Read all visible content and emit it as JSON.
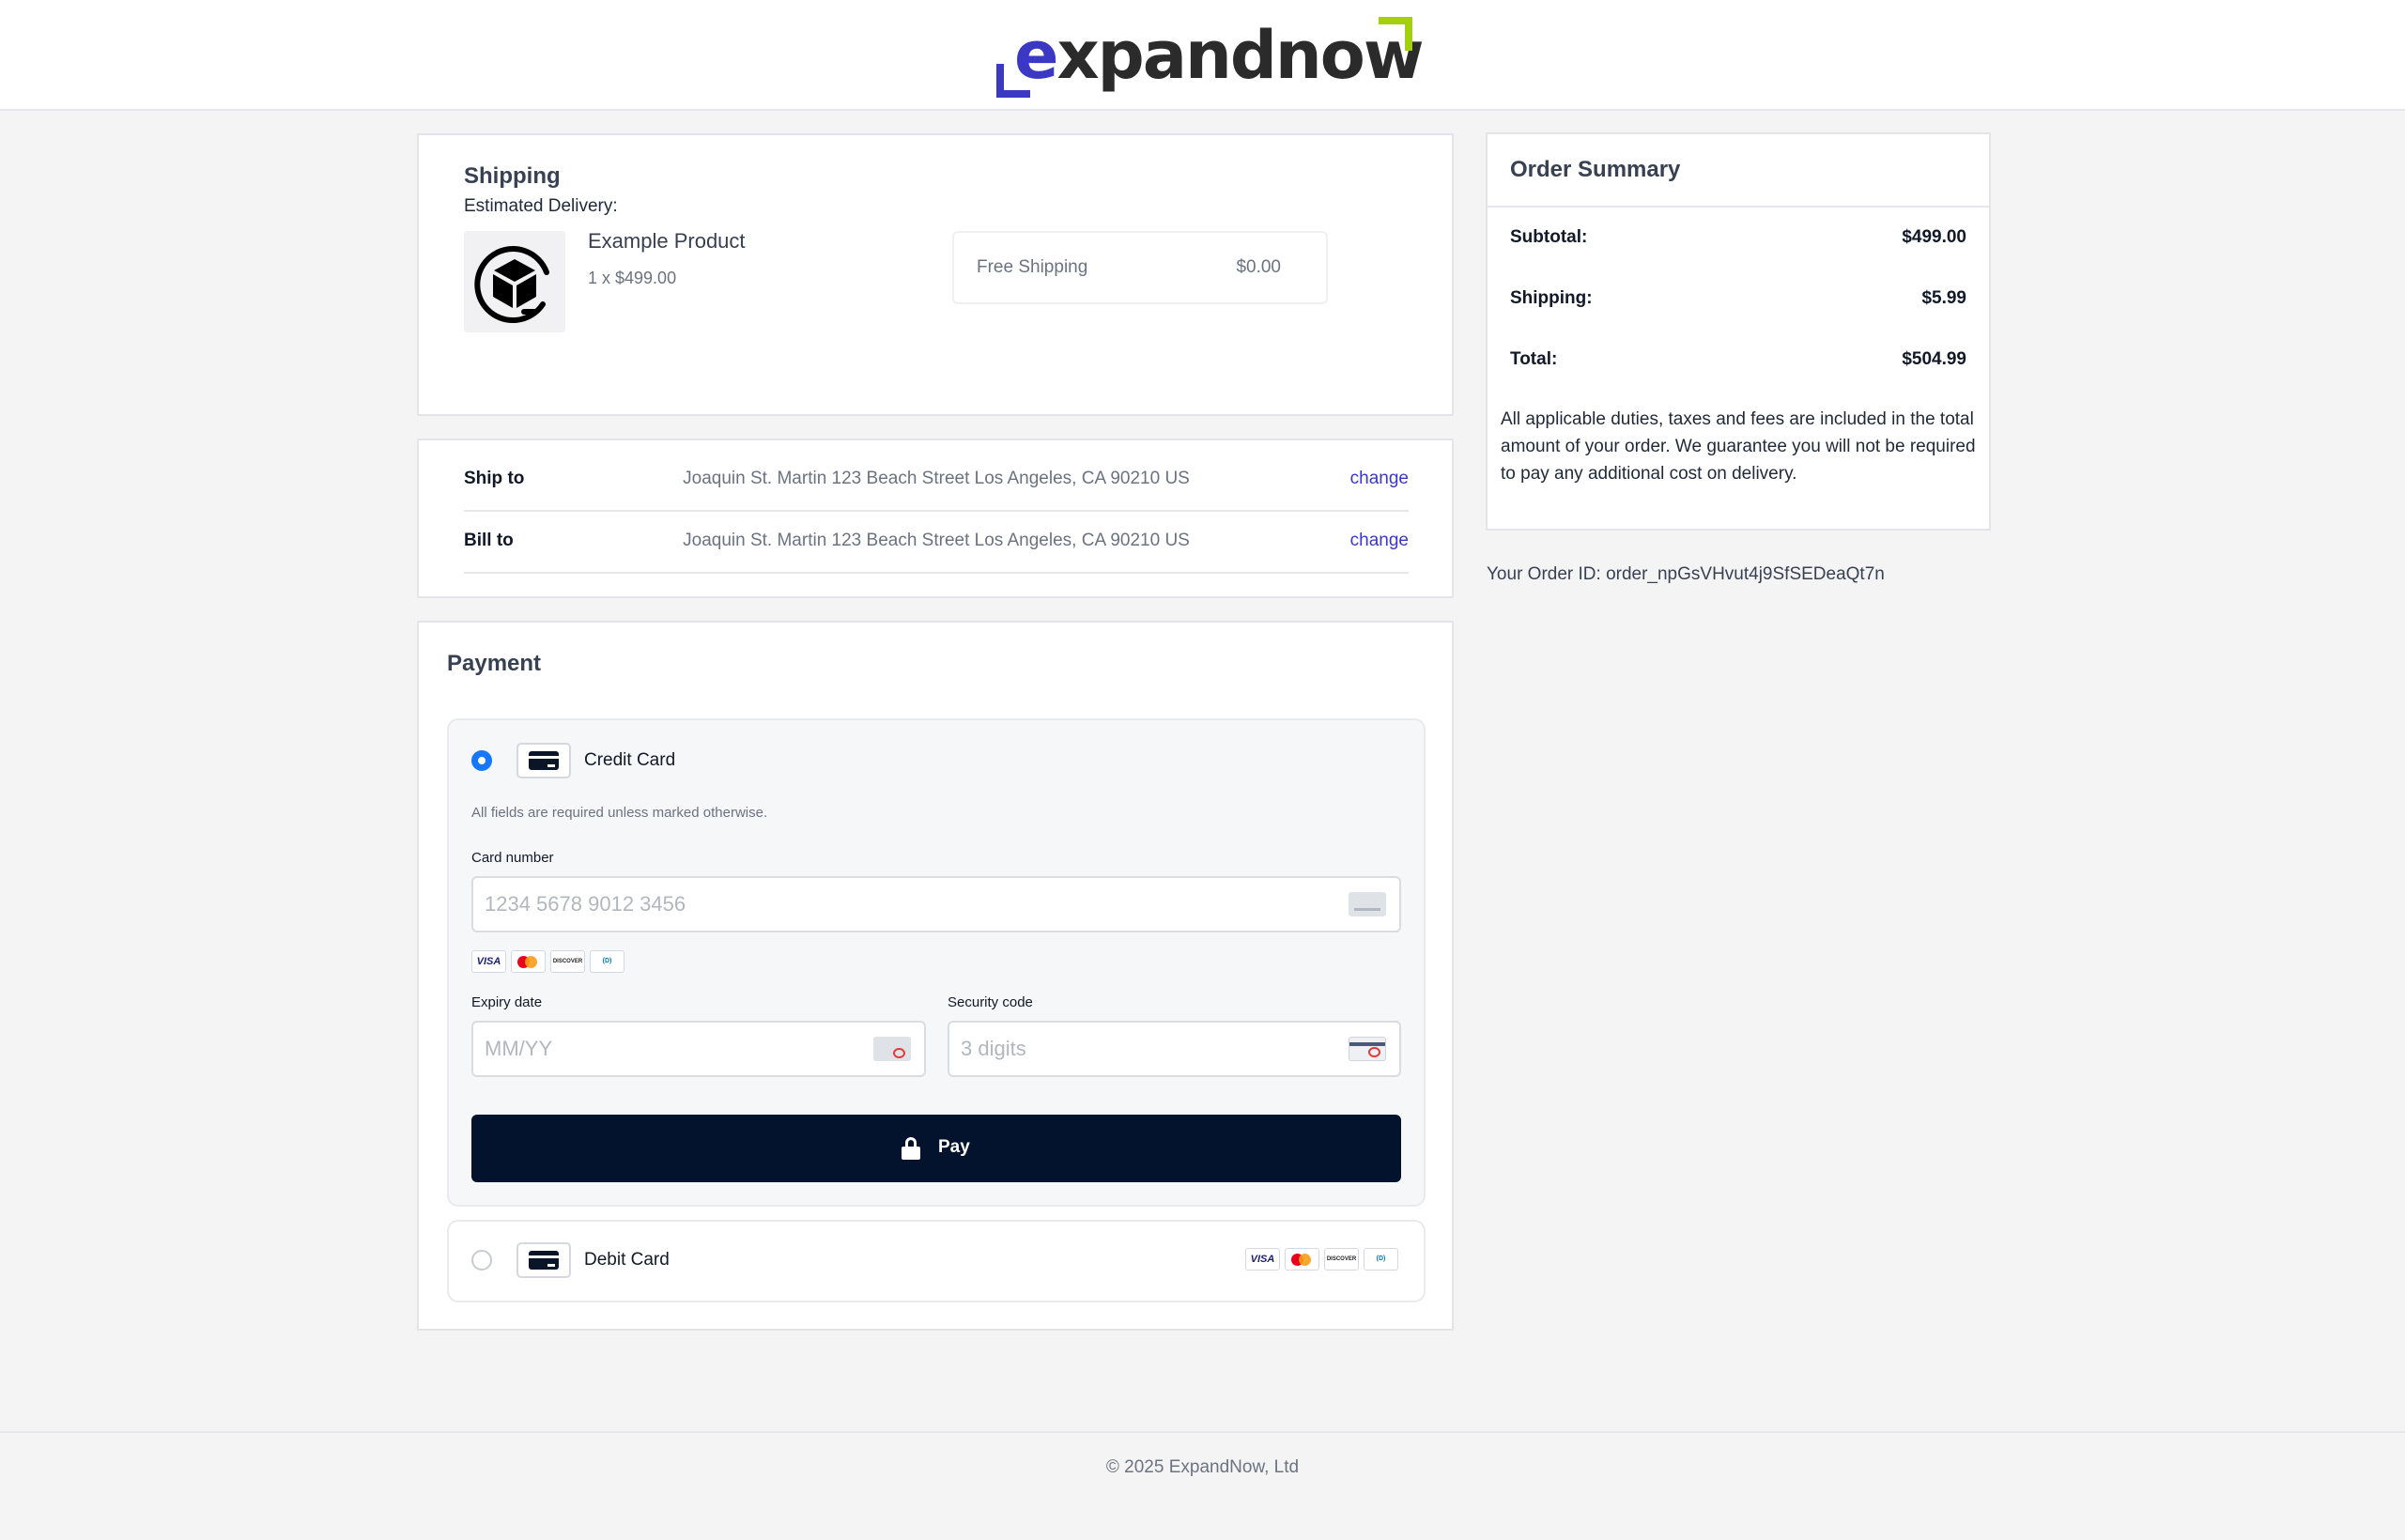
{
  "brand": {
    "logo_prefix": "e",
    "logo_rest": "xpandnow",
    "primary_color": "#3b38c4",
    "accent_color": "#a3cf0e"
  },
  "shipping": {
    "title": "Shipping",
    "estimated_delivery": "Estimated Delivery:",
    "product": {
      "icon": "package-box-icon",
      "name": "Example Product",
      "qty_price": "1 x $499.00"
    },
    "option": {
      "label": "Free Shipping",
      "price": "$0.00"
    }
  },
  "addresses": {
    "ship_to": {
      "label": "Ship to",
      "value": "Joaquin St. Martin 123 Beach Street Los Angeles, CA 90210 US",
      "change": "change"
    },
    "bill_to": {
      "label": "Bill to",
      "value": "Joaquin St. Martin 123 Beach Street Los Angeles, CA 90210 US",
      "change": "change"
    }
  },
  "payment": {
    "title": "Payment",
    "credit": {
      "label": "Credit Card",
      "selected": true,
      "required_note": "All fields are required unless marked otherwise.",
      "card_number_label": "Card number",
      "card_number_placeholder": "1234 5678 9012 3456",
      "brands": [
        "VISA",
        "MC",
        "DISCOVER",
        "Diners"
      ],
      "expiry_label": "Expiry date",
      "expiry_placeholder": "MM/YY",
      "cvc_label": "Security code",
      "cvc_placeholder": "3 digits",
      "pay_button": "Pay"
    },
    "debit": {
      "label": "Debit Card",
      "selected": false
    }
  },
  "summary": {
    "title": "Order Summary",
    "subtotal_label": "Subtotal:",
    "subtotal": "$499.00",
    "shipping_label": "Shipping:",
    "shipping": "$5.99",
    "total_label": "Total:",
    "total": "$504.99",
    "note": "All applicable duties, taxes and fees are included in the total amount of your order. We guarantee you will not be required to pay any additional cost on delivery."
  },
  "order_id": "Your Order ID: order_npGsVHvut4j9SfSEDeaQt7n",
  "footer": "© 2025 ExpandNow, Ltd"
}
